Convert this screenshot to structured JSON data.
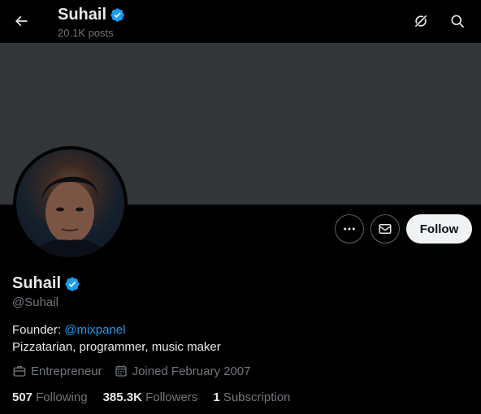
{
  "header": {
    "name": "Suhail",
    "posts": "20.1K posts"
  },
  "actions": {
    "follow_label": "Follow"
  },
  "profile": {
    "name": "Suhail",
    "handle": "@Suhail",
    "bio_prefix": "Founder: ",
    "bio_link": "@mixpanel",
    "bio_line2": "Pizzatarian, programmer, music maker",
    "profession": "Entrepreneur",
    "joined": "Joined February 2007"
  },
  "stats": {
    "following_count": "507",
    "following_label": "Following",
    "followers_count": "385.3K",
    "followers_label": "Followers",
    "subscription_count": "1",
    "subscription_label": "Subscription"
  },
  "colors": {
    "accent": "#1d9bf0",
    "background": "#000000",
    "banner": "#333639",
    "muted": "#71767b"
  },
  "icons": [
    "back-arrow-icon",
    "verified-badge-icon",
    "grok-icon",
    "search-icon",
    "more-icon",
    "message-icon",
    "briefcase-icon",
    "calendar-icon"
  ]
}
